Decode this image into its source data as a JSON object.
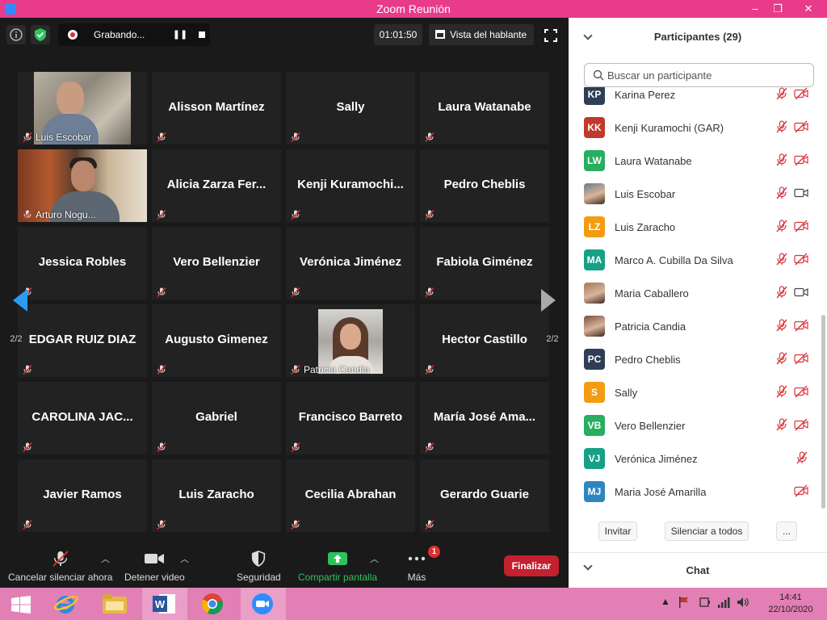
{
  "window": {
    "title": "Zoom Reunión",
    "minimize": "‒",
    "restore": "❐",
    "close": "✕"
  },
  "top_bar": {
    "recording_label": "Grabando...",
    "pause_label": "❚❚",
    "timer": "01:01:50",
    "view_label": "Vista del hablante"
  },
  "grid": {
    "tiles": [
      {
        "name": "Luis Escobar",
        "video": "luis"
      },
      {
        "name": "Alisson Martínez"
      },
      {
        "name": "Sally"
      },
      {
        "name": "Laura Watanabe"
      },
      {
        "name": "Arturo Nogu...",
        "video": "arturo"
      },
      {
        "name": "Alicia Zarza Fer..."
      },
      {
        "name": "Kenji  Kuramochi..."
      },
      {
        "name": "Pedro Cheblis"
      },
      {
        "name": "Jessica Robles"
      },
      {
        "name": "Vero Bellenzier"
      },
      {
        "name": "Verónica Jiménez"
      },
      {
        "name": "Fabiola Giménez"
      },
      {
        "name": "EDGAR RUIZ DIAZ"
      },
      {
        "name": "Augusto Gimenez"
      },
      {
        "name": "Patricia Candia",
        "video": "patricia"
      },
      {
        "name": "Hector Castillo"
      },
      {
        "name": "CAROLINA JAC..."
      },
      {
        "name": "Gabriel"
      },
      {
        "name": "Francisco Barreto"
      },
      {
        "name": "María José Ama..."
      },
      {
        "name": "Javier Ramos"
      },
      {
        "name": "Luis Zaracho"
      },
      {
        "name": "Cecilia Abrahan"
      },
      {
        "name": "Gerardo Guarie"
      }
    ],
    "page_left": "2/2",
    "page_right": "2/2"
  },
  "toolbar": {
    "mute_label": "Cancelar silenciar ahora",
    "video_label": "Detener video",
    "security_label": "Seguridad",
    "share_label": "Compartir pantalla",
    "more_label": "Más",
    "more_badge": "1",
    "end_label": "Finalizar",
    "share_color": "#2dc35b",
    "end_color": "#c4202f"
  },
  "participants_panel": {
    "title": "Participantes (29)",
    "search_placeholder": "Buscar un participante",
    "participants": [
      {
        "initials": "KP",
        "name": "Karina Perez",
        "color": "#2f3e56",
        "mic": "muted",
        "cam": "off"
      },
      {
        "initials": "KK",
        "name": "Kenji Kuramochi (GAR)",
        "color": "#c0392b",
        "mic": "muted",
        "cam": "off"
      },
      {
        "initials": "LW",
        "name": "Laura Watanabe",
        "color": "#27ae60",
        "mic": "muted",
        "cam": "off"
      },
      {
        "initials": "",
        "name": "Luis Escobar",
        "color": "#6b7b8c",
        "photo": true,
        "mic": "muted",
        "cam": "on"
      },
      {
        "initials": "LZ",
        "name": "Luis Zaracho",
        "color": "#f39c12",
        "mic": "muted",
        "cam": "off"
      },
      {
        "initials": "MA",
        "name": "Marco A. Cubilla Da Silva",
        "color": "#16a085",
        "mic": "muted",
        "cam": "off"
      },
      {
        "initials": "",
        "name": "Maria Caballero",
        "color": "#a07a5a",
        "photo": true,
        "mic": "muted",
        "cam": "on"
      },
      {
        "initials": "",
        "name": "Patricia Candia",
        "color": "#7a5040",
        "photo": true,
        "mic": "muted",
        "cam": "off"
      },
      {
        "initials": "PC",
        "name": "Pedro Cheblis",
        "color": "#2f3e56",
        "mic": "muted",
        "cam": "off"
      },
      {
        "initials": "S",
        "name": "Sally",
        "color": "#f39c12",
        "mic": "muted",
        "cam": "off"
      },
      {
        "initials": "VB",
        "name": "Vero Bellenzier",
        "color": "#27ae60",
        "mic": "muted",
        "cam": "off"
      },
      {
        "initials": "VJ",
        "name": "Verónica Jiménez",
        "color": "#16a085",
        "mic": "muted",
        "cam": "none"
      },
      {
        "initials": "MJ",
        "name": "Maria José Amarilla",
        "color": "#2e86c1",
        "mic": "none",
        "cam": "off"
      }
    ],
    "invite_label": "Invitar",
    "mute_all_label": "Silenciar a todos",
    "more_label": "...",
    "chat_label": "Chat"
  },
  "taskbar": {
    "apps": [
      "windows-start",
      "internet-explorer",
      "file-explorer",
      "word",
      "chrome",
      "zoom"
    ],
    "time": "14:41",
    "date": "22/10/2020"
  }
}
